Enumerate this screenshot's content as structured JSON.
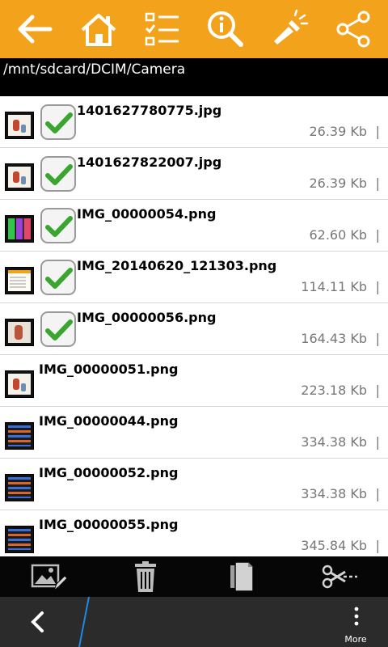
{
  "toolbar": {
    "background": "#f3a21c",
    "icons": [
      "back-arrow-icon",
      "home-icon",
      "select-list-icon",
      "info-search-icon",
      "flashlight-icon",
      "share-icon"
    ]
  },
  "path": "/mnt/sdcard/DCIM/Camera",
  "files": [
    {
      "name": "1401627780775.jpg",
      "size": "26.39 Kb",
      "separator": "|",
      "checked": true,
      "thumb": "photo"
    },
    {
      "name": "1401627822007.jpg",
      "size": "26.39 Kb",
      "separator": "|",
      "checked": true,
      "thumb": "photo"
    },
    {
      "name": "IMG_00000054.png",
      "size": "62.60 Kb",
      "separator": "|",
      "checked": true,
      "thumb": "grid"
    },
    {
      "name": "IMG_20140620_121303.png",
      "size": "114.11 Kb",
      "separator": "|",
      "checked": true,
      "thumb": "screenshot"
    },
    {
      "name": "IMG_00000056.png",
      "size": "164.43 Kb",
      "separator": "|",
      "checked": true,
      "thumb": "photo-framed"
    },
    {
      "name": "IMG_00000051.png",
      "size": "223.18 Kb",
      "separator": "|",
      "checked": false,
      "thumb": "photo"
    },
    {
      "name": "IMG_00000044.png",
      "size": "334.38 Kb",
      "separator": "|",
      "checked": false,
      "thumb": "dark-list"
    },
    {
      "name": "IMG_00000052.png",
      "size": "334.38 Kb",
      "separator": "|",
      "checked": false,
      "thumb": "dark-list"
    },
    {
      "name": "IMG_00000055.png",
      "size": "345.84 Kb",
      "separator": "|",
      "checked": false,
      "thumb": "dark-list"
    }
  ],
  "actions": {
    "icons": [
      "edit-image-icon",
      "trash-icon",
      "copy-icon",
      "cut-icon"
    ]
  },
  "system": {
    "more_label": "More"
  },
  "colors": {
    "accent": "#f3a21c",
    "check_green": "#3aa52f",
    "size_text": "#777777"
  }
}
